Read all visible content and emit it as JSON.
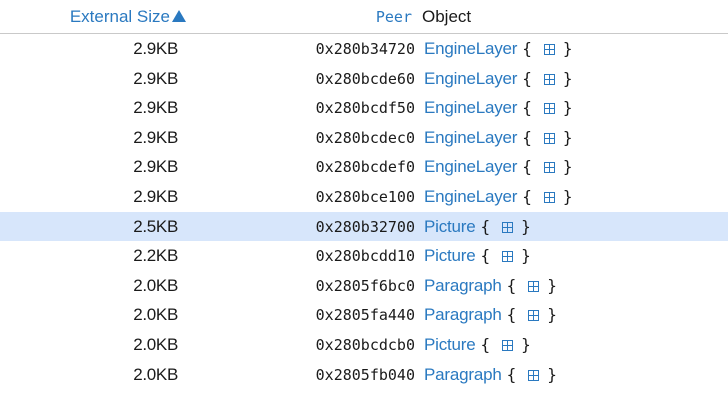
{
  "header": {
    "size_label": "External Size",
    "sort_direction": "ascending",
    "peer_label": "Peer",
    "object_label": "Object"
  },
  "rows": [
    {
      "size": "2.9KB",
      "peer": "0x280b34720",
      "class": "EngineLayer",
      "open": "{",
      "close": "}"
    },
    {
      "size": "2.9KB",
      "peer": "0x280bcde60",
      "class": "EngineLayer",
      "open": "{",
      "close": "}"
    },
    {
      "size": "2.9KB",
      "peer": "0x280bcdf50",
      "class": "EngineLayer",
      "open": "{",
      "close": "}"
    },
    {
      "size": "2.9KB",
      "peer": "0x280bcdec0",
      "class": "EngineLayer",
      "open": "{",
      "close": "}"
    },
    {
      "size": "2.9KB",
      "peer": "0x280bcdef0",
      "class": "EngineLayer",
      "open": "{",
      "close": "}"
    },
    {
      "size": "2.9KB",
      "peer": "0x280bce100",
      "class": "EngineLayer",
      "open": "{",
      "close": "}"
    },
    {
      "size": "2.5KB",
      "peer": "0x280b32700",
      "class": "Picture",
      "open": "{",
      "close": "}",
      "selected": true
    },
    {
      "size": "2.2KB",
      "peer": "0x280bcdd10",
      "class": "Picture",
      "open": "{",
      "close": "}"
    },
    {
      "size": "2.0KB",
      "peer": "0x2805f6bc0",
      "class": "Paragraph",
      "open": "{",
      "close": "}"
    },
    {
      "size": "2.0KB",
      "peer": "0x2805fa440",
      "class": "Paragraph",
      "open": "{",
      "close": "}"
    },
    {
      "size": "2.0KB",
      "peer": "0x280bcdcb0",
      "class": "Picture",
      "open": "{",
      "close": "}"
    },
    {
      "size": "2.0KB",
      "peer": "0x2805fb040",
      "class": "Paragraph",
      "open": "{",
      "close": "}"
    }
  ],
  "colors": {
    "link": "#2a79c0",
    "selected_row": "#d7e6fb",
    "text": "#1a1a1a"
  },
  "icons": {
    "sort": "sort-ascending-icon",
    "expand": "expand-icon"
  }
}
